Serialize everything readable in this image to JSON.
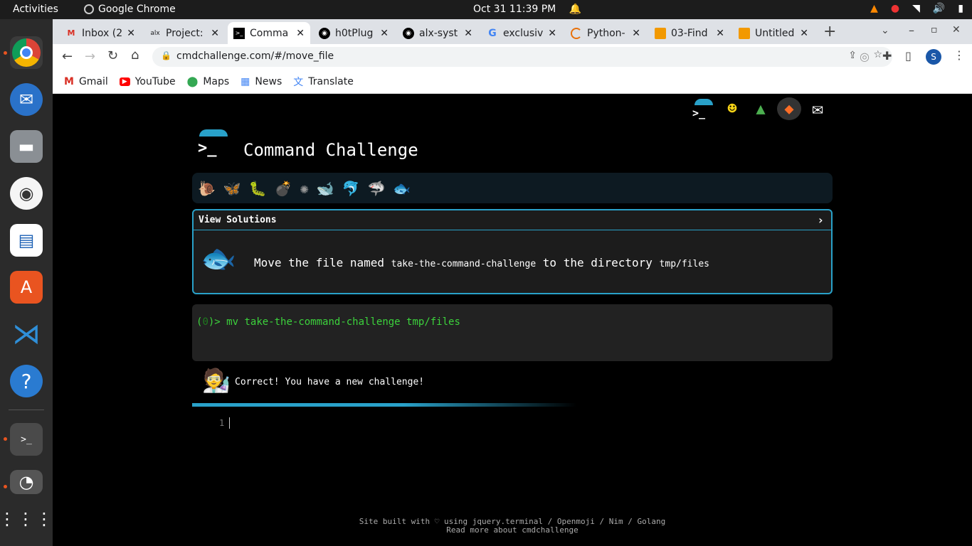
{
  "topbar": {
    "activities": "Activities",
    "app": "Google Chrome",
    "clock": "Oct 31  11:39 PM"
  },
  "tabs": [
    {
      "label": "Inbox (2",
      "icon": "gmail-icon"
    },
    {
      "label": "Project:",
      "icon": "alx-icon"
    },
    {
      "label": "Comma",
      "icon": "terminal-icon"
    },
    {
      "label": "h0tPlug",
      "icon": "github-icon"
    },
    {
      "label": "alx-syst",
      "icon": "github-icon"
    },
    {
      "label": "exclusiv",
      "icon": "google-icon"
    },
    {
      "label": "Python-",
      "icon": "loading-icon"
    },
    {
      "label": "03-Find",
      "icon": "book-icon"
    },
    {
      "label": "Untitled",
      "icon": "book-icon"
    }
  ],
  "url": "cmdchallenge.com/#/move_file",
  "profile_initial": "S",
  "bookmarks": [
    "Gmail",
    "YouTube",
    "Maps",
    "News",
    "Translate"
  ],
  "site": {
    "title": "Command Challenge",
    "view_solutions": "View Solutions",
    "expand_arrow": "›",
    "challenge": {
      "p1": "Move the file named ",
      "c1": "take-the-command-challenge",
      "p2": " to the directory ",
      "c2": "tmp/files"
    },
    "prompt_prefix": "(",
    "prompt_code": "0",
    "prompt_suffix": ")> ",
    "command": "mv take-the-command-challenge tmp/files",
    "result": "Correct! You have a new challenge!",
    "line_no": "1",
    "footer1": "Site built with ♡ using jquery.terminal / Openmoji / Nim / Golang",
    "footer2": "Read more about cmdchallenge"
  },
  "colors": {
    "accent": "#29a1c9",
    "prompt_green": "#3cd23c",
    "ubuntu_orange": "#e95420"
  }
}
